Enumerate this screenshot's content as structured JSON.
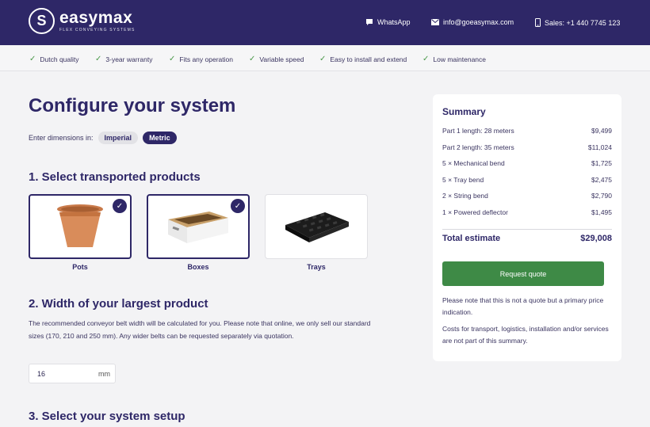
{
  "header": {
    "logo_mark": "S",
    "logo_name": "easymax",
    "logo_tagline": "FLEX CONVEYING SYSTEMS",
    "whatsapp": "WhatsApp",
    "email": "info@goeasymax.com",
    "sales": "Sales: +1 440 7745 123"
  },
  "usps": [
    "Dutch quality",
    "3-year warranty",
    "Fits any operation",
    "Variable speed",
    "Easy to install and extend",
    "Low maintenance"
  ],
  "page_title": "Configure your system",
  "units": {
    "label": "Enter dimensions in:",
    "imperial": "Imperial",
    "metric": "Metric",
    "selected": "Metric"
  },
  "section1": {
    "title": "1. Select transported products",
    "products": [
      {
        "label": "Pots",
        "selected": true
      },
      {
        "label": "Boxes",
        "selected": true
      },
      {
        "label": "Trays",
        "selected": false
      }
    ]
  },
  "section2": {
    "title": "2. Width of your largest product",
    "description": "The recommended conveyor belt width will be calculated for you. Please note that online, we only sell our standard sizes (170, 210 and 250 mm). Any wider belts can be requested separately via quotation.",
    "value": "16",
    "unit": "mm"
  },
  "section3": {
    "title": "3. Select your system setup"
  },
  "summary": {
    "title": "Summary",
    "items": [
      {
        "label": "Part 1 length: 28 meters",
        "price": "$9,499"
      },
      {
        "label": "Part 2 length: 35 meters",
        "price": "$11,024"
      },
      {
        "label": "5 × Mechanical bend",
        "price": "$1,725"
      },
      {
        "label": "5 × Tray bend",
        "price": "$2,475"
      },
      {
        "label": "2 × String bend",
        "price": "$2,790"
      },
      {
        "label": "1 × Powered deflector",
        "price": "$1,495"
      }
    ],
    "total_label": "Total estimate",
    "total_value": "$29,008",
    "button": "Request quote",
    "note1": "Please note that this is not a quote but a primary price indication.",
    "note2": "Costs for transport, logistics, installation and/or services are not part of this summary."
  },
  "colors": {
    "brand": "#2e2767",
    "accent_green": "#3e8a46",
    "check_green": "#4c9a4c"
  }
}
